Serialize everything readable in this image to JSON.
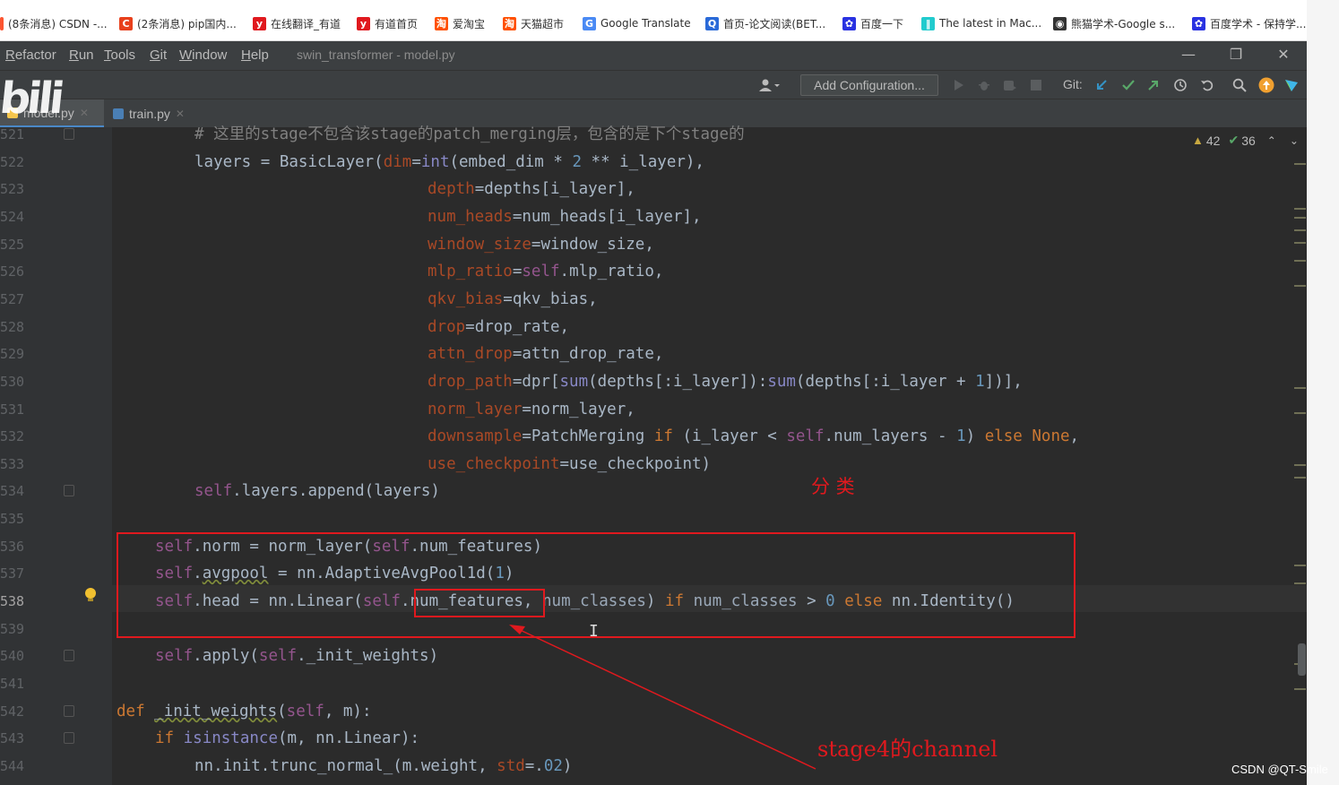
{
  "bookmarks": [
    {
      "label": "(8条消息) CSDN -...",
      "icon": "csdn-icon",
      "color": "#fc5531",
      "glyph": ""
    },
    {
      "label": "(2条消息) pip国内...",
      "icon": "csdn-c-icon",
      "color": "#e8401c",
      "glyph": "C"
    },
    {
      "label": "在线翻译_有道",
      "icon": "youdao-icon",
      "color": "#e0191e",
      "glyph": "y"
    },
    {
      "label": "有道首页",
      "icon": "youdao-icon",
      "color": "#e0191e",
      "glyph": "y"
    },
    {
      "label": "爱淘宝",
      "icon": "taobao-icon",
      "color": "#ff5000",
      "glyph": "淘"
    },
    {
      "label": "天猫超市",
      "icon": "tmall-icon",
      "color": "#ff5000",
      "glyph": "淘"
    },
    {
      "label": "Google Translate",
      "icon": "google-translate-icon",
      "color": "#4a8af4",
      "glyph": "G"
    },
    {
      "label": "首页-论文阅读(BET...",
      "icon": "paper-icon",
      "color": "#2a6ad8",
      "glyph": "Q"
    },
    {
      "label": "百度一下",
      "icon": "baidu-icon",
      "color": "#2932e1",
      "glyph": "✿"
    },
    {
      "label": "The latest in Mac...",
      "icon": "paperswithcode-icon",
      "color": "#21cbce",
      "glyph": "‖"
    },
    {
      "label": "熊猫学术-Google s...",
      "icon": "panda-icon",
      "color": "#333333",
      "glyph": "◉"
    },
    {
      "label": "百度学术 - 保持学...",
      "icon": "baidu-icon",
      "color": "#2932e1",
      "glyph": "✿"
    }
  ],
  "bookmarks_more": "»",
  "menu": [
    {
      "label": "Refactor",
      "u": "R",
      "rest": "efactor"
    },
    {
      "label": "Run",
      "u": "R",
      "rest": "un"
    },
    {
      "label": "Tools",
      "u": "T",
      "rest": "ools"
    },
    {
      "label": "Git",
      "u": "G",
      "rest": "it"
    },
    {
      "label": "Window",
      "u": "W",
      "rest": "indow"
    },
    {
      "label": "Help",
      "u": "H",
      "rest": "elp"
    }
  ],
  "window_title": "swin_transformer - model.py",
  "toolbar": {
    "add_config": "Add Configuration...",
    "git_label": "Git:"
  },
  "tabs": [
    {
      "label": "model.py",
      "active": true
    },
    {
      "label": "train.py",
      "active": false
    }
  ],
  "logo_text": "bili",
  "inspections": {
    "warnings": "42",
    "weak": "36"
  },
  "current_line": 538,
  "lines": [
    {
      "num": "521",
      "indent": 12,
      "fold": true,
      "tokens": [
        [
          "c-cmt",
          "# 这里的stage不包含该stage的patch_merging层，包含的是下个stage的"
        ]
      ]
    },
    {
      "num": "522",
      "indent": 12,
      "fold": false,
      "tokens": [
        [
          "",
          "layers = BasicLayer("
        ],
        [
          "c-param",
          "dim"
        ],
        [
          "",
          "="
        ],
        [
          "c-bi",
          "int"
        ],
        [
          "",
          "(embed_dim * "
        ],
        [
          "c-num",
          "2"
        ],
        [
          "",
          " ** i_layer),"
        ]
      ]
    },
    {
      "num": "523",
      "indent": 36,
      "fold": false,
      "tokens": [
        [
          "c-param",
          "depth"
        ],
        [
          "",
          "=depths[i_layer],"
        ]
      ]
    },
    {
      "num": "524",
      "indent": 36,
      "fold": false,
      "tokens": [
        [
          "c-param",
          "num_heads"
        ],
        [
          "",
          "=num_heads[i_layer],"
        ]
      ]
    },
    {
      "num": "525",
      "indent": 36,
      "fold": false,
      "tokens": [
        [
          "c-param",
          "window_size"
        ],
        [
          "",
          "=window_size,"
        ]
      ]
    },
    {
      "num": "526",
      "indent": 36,
      "fold": false,
      "tokens": [
        [
          "c-param",
          "mlp_ratio"
        ],
        [
          "",
          "="
        ],
        [
          "c-self",
          "self"
        ],
        [
          "",
          ".mlp_ratio,"
        ]
      ]
    },
    {
      "num": "527",
      "indent": 36,
      "fold": false,
      "tokens": [
        [
          "c-param",
          "qkv_bias"
        ],
        [
          "",
          "=qkv_bias,"
        ]
      ]
    },
    {
      "num": "528",
      "indent": 36,
      "fold": false,
      "tokens": [
        [
          "c-param",
          "drop"
        ],
        [
          "",
          "=drop_rate,"
        ]
      ]
    },
    {
      "num": "529",
      "indent": 36,
      "fold": false,
      "tokens": [
        [
          "c-param",
          "attn_drop"
        ],
        [
          "",
          "=attn_drop_rate,"
        ]
      ]
    },
    {
      "num": "530",
      "indent": 36,
      "fold": false,
      "tokens": [
        [
          "c-param",
          "drop_path"
        ],
        [
          "",
          "=dpr["
        ],
        [
          "c-bi",
          "sum"
        ],
        [
          "",
          "(depths[:i_layer]):"
        ],
        [
          "c-bi",
          "sum"
        ],
        [
          "",
          "(depths[:i_layer + "
        ],
        [
          "c-num",
          "1"
        ],
        [
          "",
          "])],"
        ]
      ]
    },
    {
      "num": "531",
      "indent": 36,
      "fold": false,
      "tokens": [
        [
          "c-param",
          "norm_layer"
        ],
        [
          "",
          "=norm_layer,"
        ]
      ]
    },
    {
      "num": "532",
      "indent": 36,
      "fold": false,
      "tokens": [
        [
          "c-param",
          "downsample"
        ],
        [
          "",
          "=PatchMerging "
        ],
        [
          "c-kw",
          "if"
        ],
        [
          "",
          " (i_layer < "
        ],
        [
          "c-self",
          "self"
        ],
        [
          "",
          ".num_layers - "
        ],
        [
          "c-num",
          "1"
        ],
        [
          "",
          ") "
        ],
        [
          "c-kw",
          "else"
        ],
        [
          "",
          " "
        ],
        [
          "c-kw",
          "None"
        ],
        [
          "",
          ","
        ]
      ]
    },
    {
      "num": "533",
      "indent": 36,
      "fold": false,
      "tokens": [
        [
          "c-param",
          "use_checkpoint"
        ],
        [
          "",
          "=use_checkpoint)"
        ]
      ]
    },
    {
      "num": "534",
      "indent": 12,
      "fold": true,
      "tokens": [
        [
          "c-self",
          "self"
        ],
        [
          "",
          ".layers.append(layers)"
        ]
      ]
    },
    {
      "num": "535",
      "indent": 0,
      "fold": false,
      "tokens": []
    },
    {
      "num": "536",
      "indent": 8,
      "fold": false,
      "tokens": [
        [
          "c-self",
          "self"
        ],
        [
          "",
          ".norm = norm_layer("
        ],
        [
          "c-self",
          "self"
        ],
        [
          "",
          ".num_features)"
        ]
      ]
    },
    {
      "num": "537",
      "indent": 8,
      "fold": false,
      "tokens": [
        [
          "c-self",
          "self"
        ],
        [
          "",
          "."
        ],
        [
          "c-warn",
          "avgpool"
        ],
        [
          "",
          " = nn.AdaptiveAvgPool1d("
        ],
        [
          "c-num",
          "1"
        ],
        [
          "",
          ")"
        ]
      ]
    },
    {
      "num": "538",
      "indent": 8,
      "fold": false,
      "tokens": [
        [
          "c-self",
          "self"
        ],
        [
          "",
          ".head = nn.Linear("
        ],
        [
          "c-self",
          "self"
        ],
        [
          "",
          ".num_features, "
        ],
        [
          "c-dim",
          "num_classes"
        ],
        [
          "",
          ") "
        ],
        [
          "c-kw",
          "if"
        ],
        [
          "",
          " "
        ],
        [
          "c-dim",
          "num_classes"
        ],
        [
          "",
          " > "
        ],
        [
          "c-num",
          "0"
        ],
        [
          "",
          " "
        ],
        [
          "c-kw",
          "else"
        ],
        [
          "",
          " nn.Identity()"
        ]
      ]
    },
    {
      "num": "539",
      "indent": 0,
      "fold": false,
      "tokens": []
    },
    {
      "num": "540",
      "indent": 8,
      "fold": true,
      "tokens": [
        [
          "c-self",
          "self"
        ],
        [
          "",
          ".apply("
        ],
        [
          "c-self",
          "self"
        ],
        [
          "",
          "._init_weights)"
        ]
      ]
    },
    {
      "num": "541",
      "indent": 0,
      "fold": false,
      "tokens": []
    },
    {
      "num": "542",
      "indent": 4,
      "fold": true,
      "tokens": [
        [
          "c-kw",
          "def"
        ],
        [
          "",
          " "
        ],
        [
          "c-fn c-warn",
          "_init_weights"
        ],
        [
          "",
          "("
        ],
        [
          "c-self",
          "self"
        ],
        [
          "",
          ", m):"
        ]
      ]
    },
    {
      "num": "543",
      "indent": 8,
      "fold": true,
      "tokens": [
        [
          "c-kw",
          "if"
        ],
        [
          "",
          " "
        ],
        [
          "c-bi",
          "isinstance"
        ],
        [
          "",
          "(m, nn.Linear):"
        ]
      ]
    },
    {
      "num": "544",
      "indent": 12,
      "fold": false,
      "tokens": [
        [
          "",
          "nn.init.trunc_normal_(m.weight, "
        ],
        [
          "c-param",
          "std"
        ],
        [
          "",
          "=."
        ],
        [
          "c-num",
          "02"
        ],
        [
          "",
          ")"
        ]
      ]
    }
  ],
  "annotations": {
    "classify_label": "分 类",
    "channel_label": "stage4的channel"
  },
  "watermark": "CSDN @QT-Smile"
}
